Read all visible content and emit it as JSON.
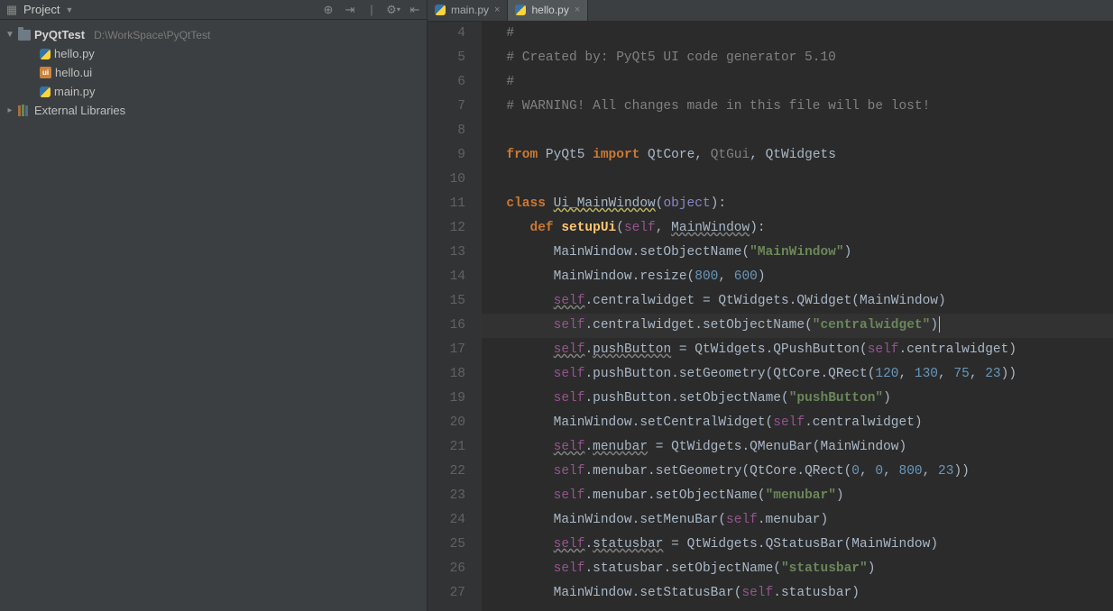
{
  "sidebar": {
    "title": "Project",
    "tool_icons": [
      "target-icon",
      "collapse-icon",
      "gear-icon",
      "hide-icon"
    ],
    "project": {
      "name": "PyQtTest",
      "path": "D:\\WorkSpace\\PyQtTest"
    },
    "files": [
      {
        "name": "hello.py",
        "icon": "py"
      },
      {
        "name": "hello.ui",
        "icon": "ui"
      },
      {
        "name": "main.py",
        "icon": "py"
      }
    ],
    "ext_lib_label": "External Libraries"
  },
  "tabs": [
    {
      "label": "main.py",
      "active": false
    },
    {
      "label": "hello.py",
      "active": true
    }
  ],
  "editor": {
    "first_line_no": 4,
    "highlight_abs_line": 16,
    "comments": {
      "l4": "#",
      "l5": "# Created by: PyQt5 UI code generator 5.10",
      "l6": "#",
      "l7": "# WARNING! All changes made in this file will be lost!"
    },
    "code": {
      "from": "from",
      "import": "import",
      "pyqt5": "PyQt5",
      "qtcore": "QtCore",
      "qtgui": "QtGui",
      "qtwidgets": "QtWidgets",
      "class": "class",
      "clsname": "Ui_MainWindow",
      "object": "object",
      "def": "def",
      "setup": "setupUi",
      "selfp": "self",
      "mainwin": "MainWindow",
      "setobj": "setObjectName",
      "s_mainwin": "\"MainWindow\"",
      "resize": "resize",
      "n800": "800",
      "n600": "600",
      "cw": "centralwidget",
      "qwidget": "QWidget",
      "s_cw": "\"centralwidget\"",
      "pb": "pushButton",
      "qpb": "QPushButton",
      "setgeo": "setGeometry",
      "qrect": "QRect",
      "n120": "120",
      "n130": "130",
      "n75": "75",
      "n23": "23",
      "s_pb": "\"pushButton\"",
      "setcw": "setCentralWidget",
      "mb": "menubar",
      "qmb": "QMenuBar",
      "n0": "0",
      "s_mb": "\"menubar\"",
      "setmb": "setMenuBar",
      "sb": "statusbar",
      "qsb": "QStatusBar",
      "s_sb": "\"statusbar\"",
      "setsb": "setStatusBar"
    }
  }
}
